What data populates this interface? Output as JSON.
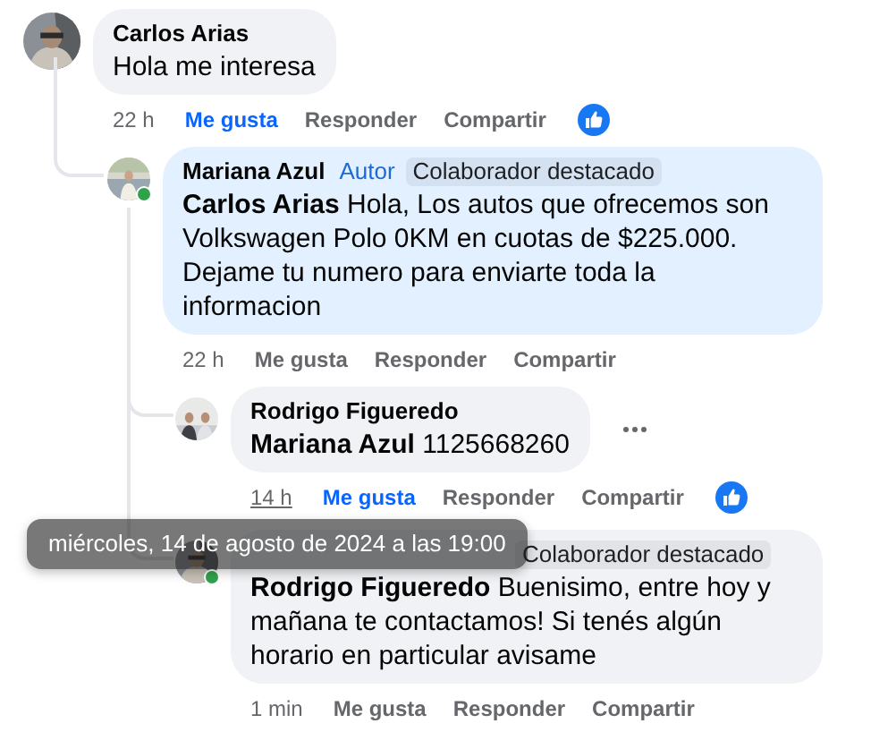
{
  "comments": [
    {
      "author": "Carlos Arias",
      "text": "Hola me interesa",
      "time": "22 h",
      "reaction_icon": true,
      "actions": [
        {
          "label": "Me gusta",
          "active": true
        },
        {
          "label": "Responder",
          "active": false
        },
        {
          "label": "Compartir",
          "active": false
        }
      ],
      "replies": [
        {
          "author": "Mariana Azul",
          "author_label": "Autor",
          "badge": "Colaborador destacado",
          "text": "**Carlos Arias** Hola, Los autos que ofrecemos son Volkswagen Polo 0KM en cuotas de $225.000. Dejame tu numero para enviarte toda la informacion",
          "online": true,
          "highlighted": true,
          "time": "22 h",
          "actions": [
            {
              "label": "Me gusta",
              "active": false
            },
            {
              "label": "Responder",
              "active": false
            },
            {
              "label": "Compartir",
              "active": false
            }
          ],
          "replies": [
            {
              "author": "Rodrigo Figueredo",
              "text": "**Mariana Azul** 1125668260",
              "menu_visible": true,
              "time": "14 h",
              "time_hovered": true,
              "reaction_icon": true,
              "actions": [
                {
                  "label": "Me gusta",
                  "active": true
                },
                {
                  "label": "Responder",
                  "active": false
                },
                {
                  "label": "Compartir",
                  "active": false
                }
              ]
            },
            {
              "badge": "Colaborador destacado",
              "text": "**Rodrigo Figueredo** Buenisimo, entre hoy y mañana te contactamos! Si tenés algún horario en particular avisame",
              "online": true,
              "time": "1 min",
              "actions": [
                {
                  "label": "Me gusta",
                  "active": false
                },
                {
                  "label": "Responder",
                  "active": false
                },
                {
                  "label": "Compartir",
                  "active": false
                }
              ]
            }
          ]
        }
      ]
    }
  ],
  "tooltip": {
    "text": "miércoles, 14 de agosto de 2024 a las 19:00"
  }
}
